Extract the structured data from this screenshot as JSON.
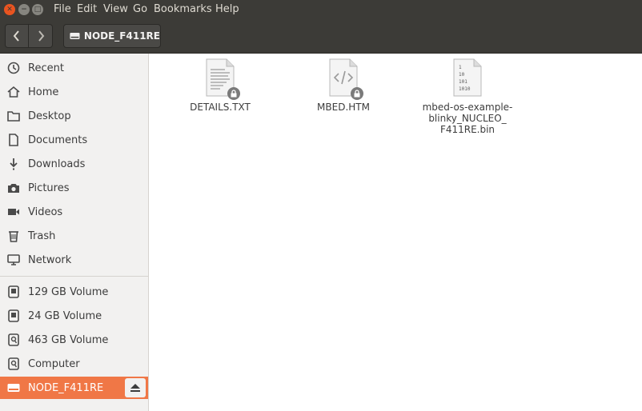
{
  "window": {
    "controls": {
      "close_icon": "close-icon",
      "minimize_icon": "minimize-icon",
      "maximize_icon": "maximize-icon"
    },
    "menu": [
      "File",
      "Edit",
      "View",
      "Go",
      "Bookmarks",
      "Help"
    ]
  },
  "toolbar": {
    "back_icon": "chevron-left-icon",
    "forward_icon": "chevron-right-icon",
    "path": "NODE_F411RE"
  },
  "sidebar": {
    "places": [
      {
        "label": "Recent",
        "icon": "clock-icon"
      },
      {
        "label": "Home",
        "icon": "home-icon"
      },
      {
        "label": "Desktop",
        "icon": "folder-icon"
      },
      {
        "label": "Documents",
        "icon": "document-icon"
      },
      {
        "label": "Downloads",
        "icon": "download-icon"
      },
      {
        "label": "Pictures",
        "icon": "camera-icon"
      },
      {
        "label": "Videos",
        "icon": "video-icon"
      },
      {
        "label": "Trash",
        "icon": "trash-icon"
      },
      {
        "label": "Network",
        "icon": "network-icon"
      }
    ],
    "devices": [
      {
        "label": "129 GB Volume",
        "icon": "drive-icon"
      },
      {
        "label": "24 GB Volume",
        "icon": "drive-icon"
      },
      {
        "label": "463 GB Volume",
        "icon": "disk-icon"
      },
      {
        "label": "Computer",
        "icon": "disk-icon"
      },
      {
        "label": "NODE_F411RE",
        "icon": "usb-drive-icon",
        "selected": true
      }
    ],
    "eject_icon": "eject-icon",
    "accent_color": "#f07746"
  },
  "files": [
    {
      "name": "DETAILS.TXT",
      "icon": "text-file-icon",
      "locked": true
    },
    {
      "name": "MBED.HTM",
      "icon": "html-file-icon",
      "locked": true
    },
    {
      "name_lines": [
        "mbed-os-example-",
        "blinky_NUCLEO_",
        "F411RE.bin"
      ],
      "icon": "binary-file-icon",
      "locked": false,
      "binary_lines": [
        "1",
        "10",
        "101",
        "1010"
      ]
    }
  ]
}
